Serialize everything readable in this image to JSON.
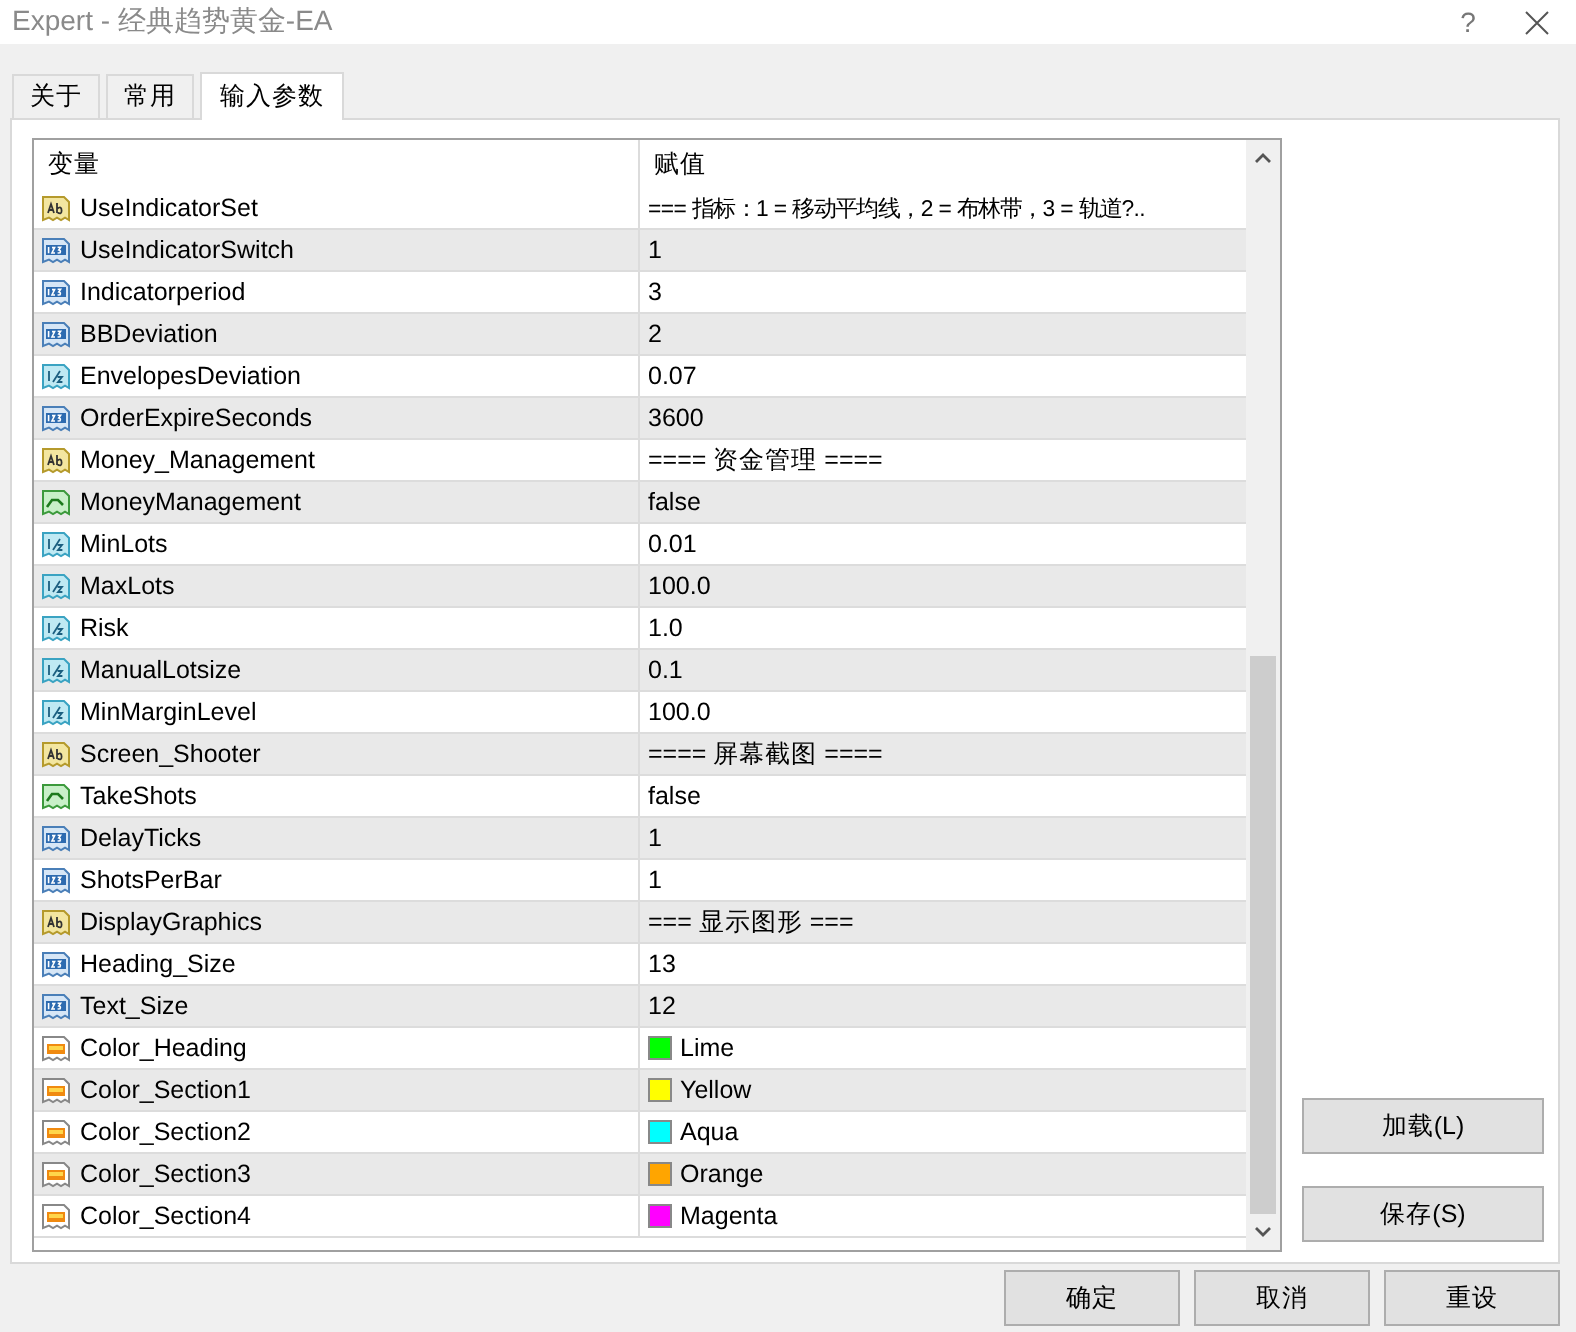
{
  "window": {
    "title": "Expert - 经典趋势黄金-EA",
    "help": "?"
  },
  "tabs": [
    {
      "label": "关于",
      "selected": false
    },
    {
      "label": "常用",
      "selected": false
    },
    {
      "label": "输入参数",
      "selected": true
    }
  ],
  "table": {
    "columns": [
      "变量",
      "赋值"
    ],
    "rows": [
      {
        "kind": "string",
        "name": "UseIndicatorSet",
        "value": "=== 指标：1 = 移动平均线，2 = 布林带，3 = 轨道?.."
      },
      {
        "kind": "int",
        "name": "UseIndicatorSwitch",
        "value": "1"
      },
      {
        "kind": "int",
        "name": "Indicatorperiod",
        "value": "3"
      },
      {
        "kind": "int",
        "name": "BBDeviation",
        "value": "2"
      },
      {
        "kind": "double",
        "name": "EnvelopesDeviation",
        "value": "0.07"
      },
      {
        "kind": "int",
        "name": "OrderExpireSeconds",
        "value": "3600"
      },
      {
        "kind": "string",
        "name": "Money_Management",
        "value": "==== 资金管理 ===="
      },
      {
        "kind": "bool",
        "name": "MoneyManagement",
        "value": "false"
      },
      {
        "kind": "double",
        "name": "MinLots",
        "value": "0.01"
      },
      {
        "kind": "double",
        "name": "MaxLots",
        "value": "100.0"
      },
      {
        "kind": "double",
        "name": "Risk",
        "value": "1.0"
      },
      {
        "kind": "double",
        "name": "ManualLotsize",
        "value": "0.1"
      },
      {
        "kind": "double",
        "name": "MinMarginLevel",
        "value": "100.0"
      },
      {
        "kind": "string",
        "name": "Screen_Shooter",
        "value": "==== 屏幕截图 ===="
      },
      {
        "kind": "bool",
        "name": "TakeShots",
        "value": "false"
      },
      {
        "kind": "int",
        "name": "DelayTicks",
        "value": "1"
      },
      {
        "kind": "int",
        "name": "ShotsPerBar",
        "value": "1"
      },
      {
        "kind": "string",
        "name": "DisplayGraphics",
        "value": "=== 显示图形 ==="
      },
      {
        "kind": "int",
        "name": "Heading_Size",
        "value": "13"
      },
      {
        "kind": "int",
        "name": "Text_Size",
        "value": "12"
      },
      {
        "kind": "color",
        "name": "Color_Heading",
        "value": "Lime",
        "color": "#00ff00"
      },
      {
        "kind": "color",
        "name": "Color_Section1",
        "value": "Yellow",
        "color": "#ffff00"
      },
      {
        "kind": "color",
        "name": "Color_Section2",
        "value": "Aqua",
        "color": "#00ffff"
      },
      {
        "kind": "color",
        "name": "Color_Section3",
        "value": "Orange",
        "color": "#ffa500"
      },
      {
        "kind": "color",
        "name": "Color_Section4",
        "value": "Magenta",
        "color": "#ff00ff"
      }
    ]
  },
  "side_buttons": [
    "加载(L)",
    "保存(S)"
  ],
  "footer_buttons": [
    "确定",
    "取消",
    "重设"
  ]
}
